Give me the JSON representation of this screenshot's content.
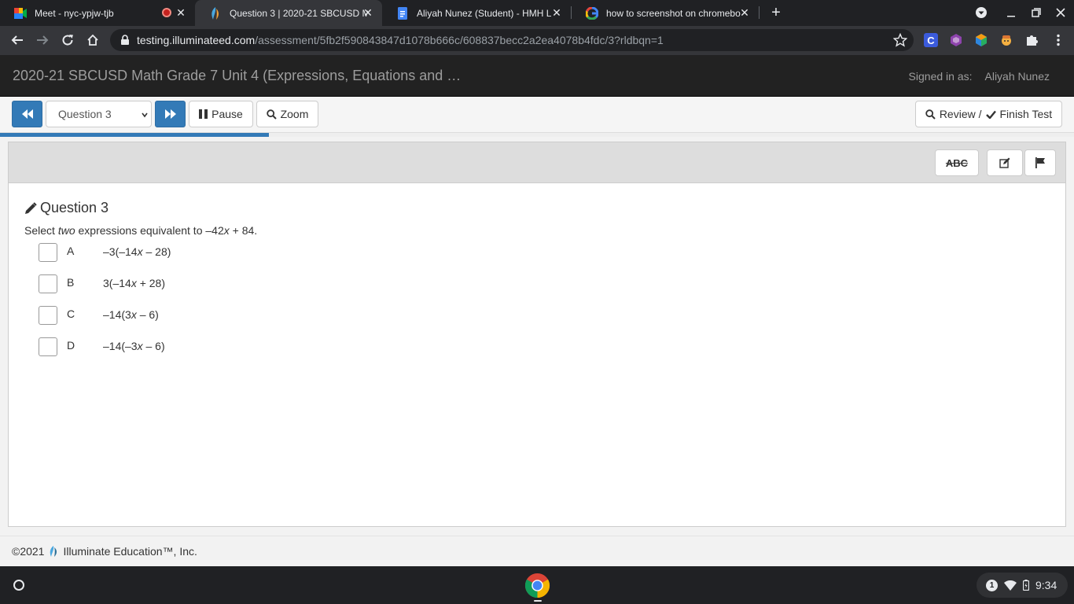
{
  "browser": {
    "tabs": [
      {
        "title": "Meet - nyc-ypjw-tjb",
        "favicon": "google-meet-icon",
        "recording": true,
        "active": false
      },
      {
        "title": "Question 3 | 2020-21 SBCUSD M",
        "favicon": "illuminate-icon",
        "active": true
      },
      {
        "title": "Aliyah Nunez (Student) - HMH L",
        "favicon": "google-docs-icon",
        "active": false
      },
      {
        "title": "how to screenshot on chromebo",
        "favicon": "google-icon",
        "active": false
      }
    ],
    "url_host": "testing.illuminateed.com",
    "url_path": "/assessment/5fb2f590843847d1078b666c/608837becc2a2ea4078b4fdc/3?rldbqn=1"
  },
  "header": {
    "title": "2020-21 SBCUSD Math Grade 7 Unit 4 (Expressions, Equations and …",
    "signed_in_label": "Signed in as:",
    "user_name": "Aliyah Nunez"
  },
  "nav": {
    "question_select": "Question 3",
    "pause_label": "Pause",
    "zoom_label": "Zoom",
    "review_label": "Review /",
    "finish_label": "Finish Test",
    "progress_fraction": 0.25
  },
  "tools": {
    "spellcheck_label": "ABC"
  },
  "question": {
    "heading": "Question 3",
    "prompt_pre": "Select ",
    "prompt_em": "two",
    "prompt_mid": " expressions equivalent to –42",
    "prompt_var": "x",
    "prompt_post": " + 84.",
    "choices": [
      {
        "letter": "A",
        "pre": "–3(–14",
        "var": "x",
        "post": " – 28)"
      },
      {
        "letter": "B",
        "pre": "3(–14",
        "var": "x",
        "post": " + 28)"
      },
      {
        "letter": "C",
        "pre": "–14(3",
        "var": "x",
        "post": " – 6)"
      },
      {
        "letter": "D",
        "pre": "–14(–3",
        "var": "x",
        "post": " – 6)"
      }
    ]
  },
  "footer": {
    "copyright": "©2021",
    "company": "Illuminate Education™, Inc."
  },
  "shelf": {
    "notification_count": "1",
    "time": "9:34"
  },
  "colors": {
    "primary": "#337ab7",
    "header_bg": "#222222",
    "tab_strip": "#202124"
  }
}
